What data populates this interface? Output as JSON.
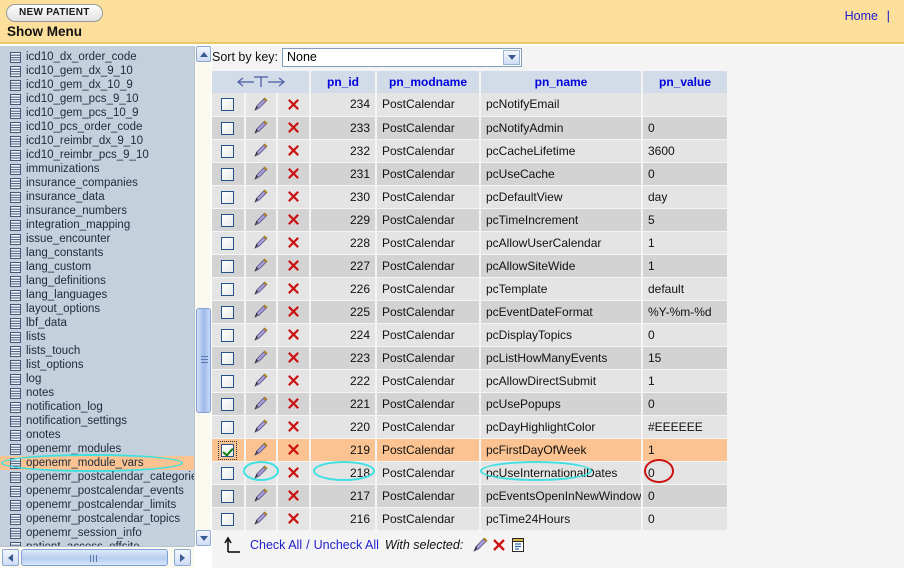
{
  "header": {
    "new_patient_label": "NEW PATIENT",
    "show_menu_label": "Show Menu",
    "home_label": "Home",
    "separator": "|",
    "background_color": "#fbdf9b"
  },
  "sidebar": {
    "selected": "openemr_module_vars",
    "highlight_color": "#fbc391",
    "annotation_color": "#3fe0e0",
    "items": [
      {
        "label": "icd10_dx_order_code",
        "icon": "table-icon"
      },
      {
        "label": "icd10_gem_dx_9_10",
        "icon": "table-icon"
      },
      {
        "label": "icd10_gem_dx_10_9",
        "icon": "table-icon"
      },
      {
        "label": "icd10_gem_pcs_9_10",
        "icon": "table-icon"
      },
      {
        "label": "icd10_gem_pcs_10_9",
        "icon": "table-icon"
      },
      {
        "label": "icd10_pcs_order_code",
        "icon": "table-icon"
      },
      {
        "label": "icd10_reimbr_dx_9_10",
        "icon": "table-icon"
      },
      {
        "label": "icd10_reimbr_pcs_9_10",
        "icon": "table-icon"
      },
      {
        "label": "immunizations",
        "icon": "table-icon"
      },
      {
        "label": "insurance_companies",
        "icon": "table-icon"
      },
      {
        "label": "insurance_data",
        "icon": "table-icon"
      },
      {
        "label": "insurance_numbers",
        "icon": "table-icon"
      },
      {
        "label": "integration_mapping",
        "icon": "table-icon"
      },
      {
        "label": "issue_encounter",
        "icon": "table-icon"
      },
      {
        "label": "lang_constants",
        "icon": "table-icon"
      },
      {
        "label": "lang_custom",
        "icon": "table-icon"
      },
      {
        "label": "lang_definitions",
        "icon": "table-icon"
      },
      {
        "label": "lang_languages",
        "icon": "table-icon"
      },
      {
        "label": "layout_options",
        "icon": "table-icon"
      },
      {
        "label": "lbf_data",
        "icon": "table-icon"
      },
      {
        "label": "lists",
        "icon": "table-icon"
      },
      {
        "label": "lists_touch",
        "icon": "table-icon"
      },
      {
        "label": "list_options",
        "icon": "table-icon"
      },
      {
        "label": "log",
        "icon": "table-icon"
      },
      {
        "label": "notes",
        "icon": "table-icon"
      },
      {
        "label": "notification_log",
        "icon": "table-icon"
      },
      {
        "label": "notification_settings",
        "icon": "table-icon"
      },
      {
        "label": "onotes",
        "icon": "table-icon"
      },
      {
        "label": "openemr_modules",
        "icon": "table-icon"
      },
      {
        "label": "openemr_module_vars",
        "icon": "table-icon"
      },
      {
        "label": "openemr_postcalendar_categories",
        "icon": "table-icon"
      },
      {
        "label": "openemr_postcalendar_events",
        "icon": "table-icon"
      },
      {
        "label": "openemr_postcalendar_limits",
        "icon": "table-icon"
      },
      {
        "label": "openemr_postcalendar_topics",
        "icon": "table-icon"
      },
      {
        "label": "openemr_session_info",
        "icon": "table-icon"
      },
      {
        "label": "patient_access_offsite",
        "icon": "table-icon"
      }
    ]
  },
  "main": {
    "sort_label": "Sort by key:",
    "sort_value": "None",
    "sort_options": [
      "None"
    ],
    "columns": {
      "sort_controls": "←T→",
      "pn_id": "pn_id",
      "pn_modname": "pn_modname",
      "pn_name": "pn_name",
      "pn_value": "pn_value"
    },
    "rows": [
      {
        "checked": false,
        "pn_id": "234",
        "pn_modname": "PostCalendar",
        "pn_name": "pcNotifyEmail",
        "pn_value": ""
      },
      {
        "checked": false,
        "pn_id": "233",
        "pn_modname": "PostCalendar",
        "pn_name": "pcNotifyAdmin",
        "pn_value": "0"
      },
      {
        "checked": false,
        "pn_id": "232",
        "pn_modname": "PostCalendar",
        "pn_name": "pcCacheLifetime",
        "pn_value": "3600"
      },
      {
        "checked": false,
        "pn_id": "231",
        "pn_modname": "PostCalendar",
        "pn_name": "pcUseCache",
        "pn_value": "0"
      },
      {
        "checked": false,
        "pn_id": "230",
        "pn_modname": "PostCalendar",
        "pn_name": "pcDefaultView",
        "pn_value": "day"
      },
      {
        "checked": false,
        "pn_id": "229",
        "pn_modname": "PostCalendar",
        "pn_name": "pcTimeIncrement",
        "pn_value": "5"
      },
      {
        "checked": false,
        "pn_id": "228",
        "pn_modname": "PostCalendar",
        "pn_name": "pcAllowUserCalendar",
        "pn_value": "1"
      },
      {
        "checked": false,
        "pn_id": "227",
        "pn_modname": "PostCalendar",
        "pn_name": "pcAllowSiteWide",
        "pn_value": "1"
      },
      {
        "checked": false,
        "pn_id": "226",
        "pn_modname": "PostCalendar",
        "pn_name": "pcTemplate",
        "pn_value": "default"
      },
      {
        "checked": false,
        "pn_id": "225",
        "pn_modname": "PostCalendar",
        "pn_name": "pcEventDateFormat",
        "pn_value": "%Y-%m-%d"
      },
      {
        "checked": false,
        "pn_id": "224",
        "pn_modname": "PostCalendar",
        "pn_name": "pcDisplayTopics",
        "pn_value": "0"
      },
      {
        "checked": false,
        "pn_id": "223",
        "pn_modname": "PostCalendar",
        "pn_name": "pcListHowManyEvents",
        "pn_value": "15"
      },
      {
        "checked": false,
        "pn_id": "222",
        "pn_modname": "PostCalendar",
        "pn_name": "pcAllowDirectSubmit",
        "pn_value": "1"
      },
      {
        "checked": false,
        "pn_id": "221",
        "pn_modname": "PostCalendar",
        "pn_name": "pcUsePopups",
        "pn_value": "0"
      },
      {
        "checked": false,
        "pn_id": "220",
        "pn_modname": "PostCalendar",
        "pn_name": "pcDayHighlightColor",
        "pn_value": "#EEEEEE"
      },
      {
        "checked": true,
        "highlighted": true,
        "pn_id": "219",
        "pn_modname": "PostCalendar",
        "pn_name": "pcFirstDayOfWeek",
        "pn_value": "1"
      },
      {
        "checked": false,
        "pn_id": "218",
        "pn_modname": "PostCalendar",
        "pn_name": "pcUseInternationalDates",
        "pn_value": "0"
      },
      {
        "checked": false,
        "pn_id": "217",
        "pn_modname": "PostCalendar",
        "pn_name": "pcEventsOpenInNewWindow",
        "pn_value": "0"
      },
      {
        "checked": false,
        "pn_id": "216",
        "pn_modname": "PostCalendar",
        "pn_name": "pcTime24Hours",
        "pn_value": "0"
      }
    ],
    "footer": {
      "check_all": "Check All",
      "slash": "/",
      "uncheck_all": "Uncheck All",
      "with_selected": "With selected:",
      "icons": [
        "pencil-edit-icon",
        "red-x-delete-icon",
        "export-clipboard-icon"
      ]
    }
  },
  "annotations": {
    "cyan": "#3fe0e0",
    "red": "#cc1111"
  }
}
